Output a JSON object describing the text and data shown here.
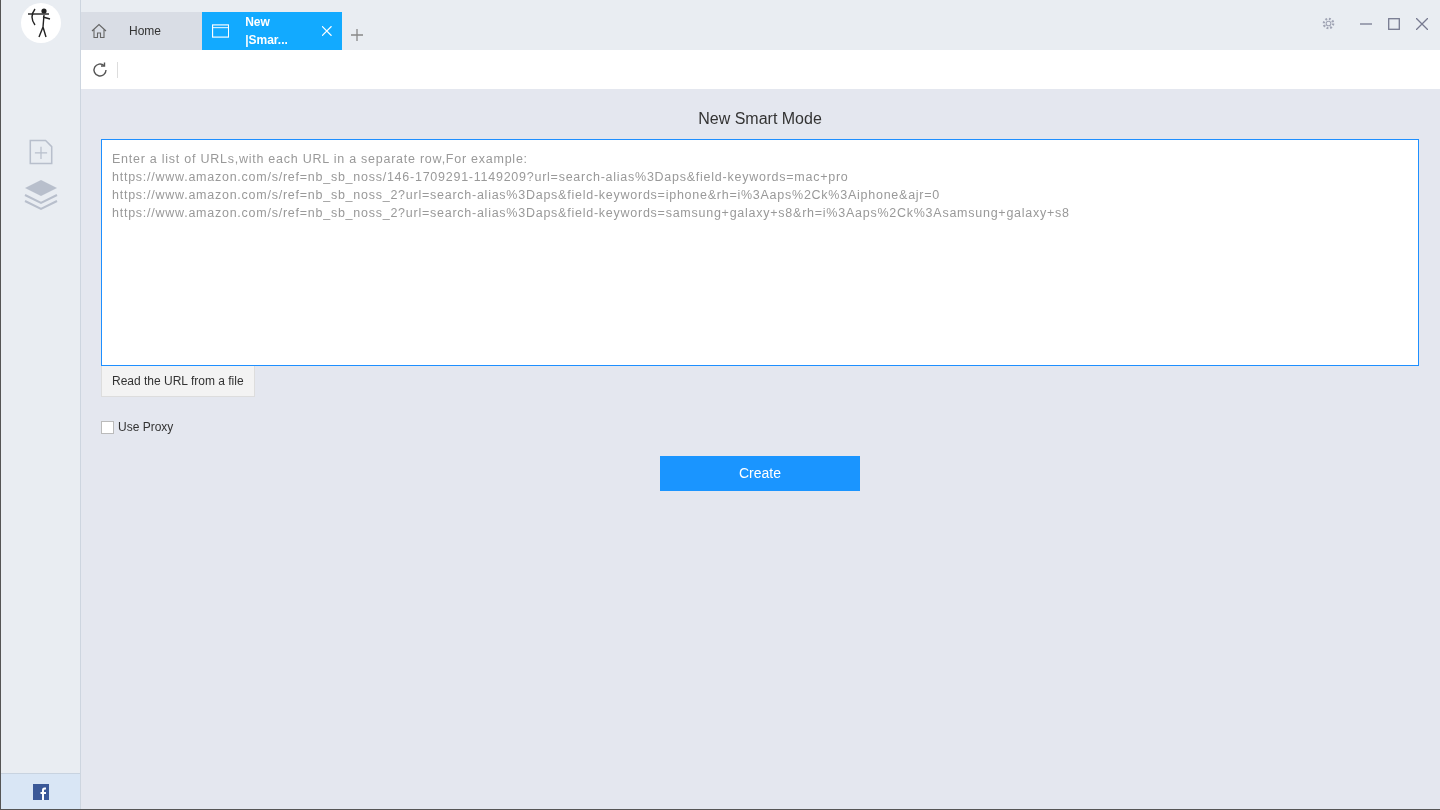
{
  "tabs": [
    {
      "kind": "home",
      "label": "Home",
      "selected": false
    },
    {
      "kind": "page",
      "label": "New |Smar...",
      "selected": true
    }
  ],
  "heading": "New Smart Mode",
  "url_input": {
    "placeholder": "Enter a list of URLs,with each URL in a separate row,For example:\nhttps://www.amazon.com/s/ref=nb_sb_noss/146-1709291-1149209?url=search-alias%3Daps&field-keywords=mac+pro\nhttps://www.amazon.com/s/ref=nb_sb_noss_2?url=search-alias%3Daps&field-keywords=iphone&rh=i%3Aaps%2Ck%3Aiphone&ajr=0\nhttps://www.amazon.com/s/ref=nb_sb_noss_2?url=search-alias%3Daps&field-keywords=samsung+galaxy+s8&rh=i%3Aaps%2Ck%3Asamsung+galaxy+s8"
  },
  "file_button": "Read the URL from a file",
  "use_proxy": {
    "label": "Use Proxy",
    "checked": false
  },
  "create_button": "Create"
}
